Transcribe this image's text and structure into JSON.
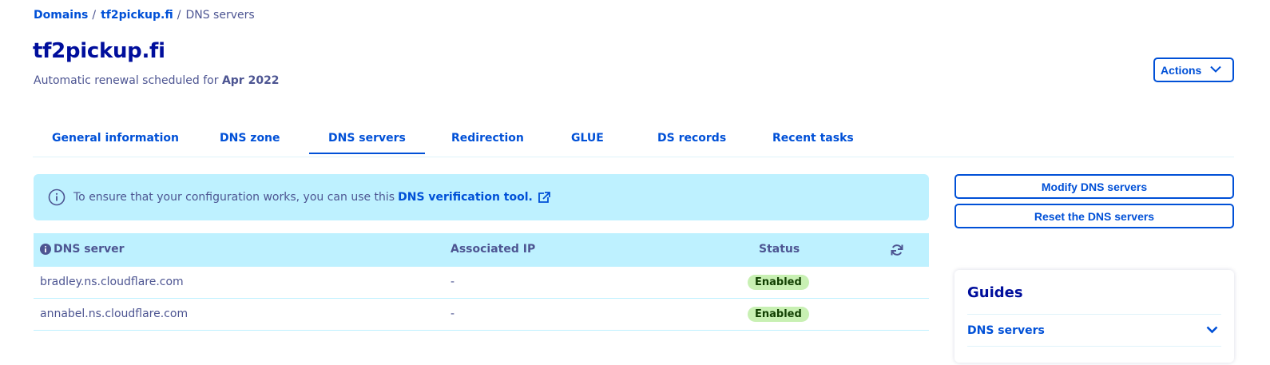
{
  "breadcrumb": {
    "items": [
      "Domains",
      "tf2pickup.fi"
    ],
    "separator": "/",
    "current": "DNS servers"
  },
  "header": {
    "title": "tf2pickup.fi",
    "renewal_prefix": "Automatic renewal scheduled for",
    "renewal_date": "Apr 2022",
    "actions_label": "Actions"
  },
  "tabs": [
    {
      "label": "General information",
      "active": false
    },
    {
      "label": "DNS zone",
      "active": false
    },
    {
      "label": "DNS servers",
      "active": true
    },
    {
      "label": "Redirection",
      "active": false
    },
    {
      "label": "GLUE",
      "active": false
    },
    {
      "label": "DS records",
      "active": false
    },
    {
      "label": "Recent tasks",
      "active": false
    }
  ],
  "info": {
    "text": "To ensure that your configuration works, you can use this",
    "link": "DNS verification tool.",
    "icon": "info-circle-icon",
    "link_icon": "external-link-icon"
  },
  "table": {
    "headers": {
      "server": "DNS server",
      "ip": "Associated IP",
      "status": "Status"
    },
    "rows": [
      {
        "server": "bradley.ns.cloudflare.com",
        "ip": "-",
        "status": "Enabled"
      },
      {
        "server": "annabel.ns.cloudflare.com",
        "ip": "-",
        "status": "Enabled"
      }
    ]
  },
  "sidebar": {
    "modify_label": "Modify DNS servers",
    "reset_label": "Reset the DNS servers",
    "guides_title": "Guides",
    "guides_item": "DNS servers"
  },
  "colors": {
    "accent": "#0050d7",
    "title": "#000e9c",
    "info_bg": "#bef1ff",
    "badge_bg": "#c8f0b3",
    "text": "#4d5592"
  }
}
